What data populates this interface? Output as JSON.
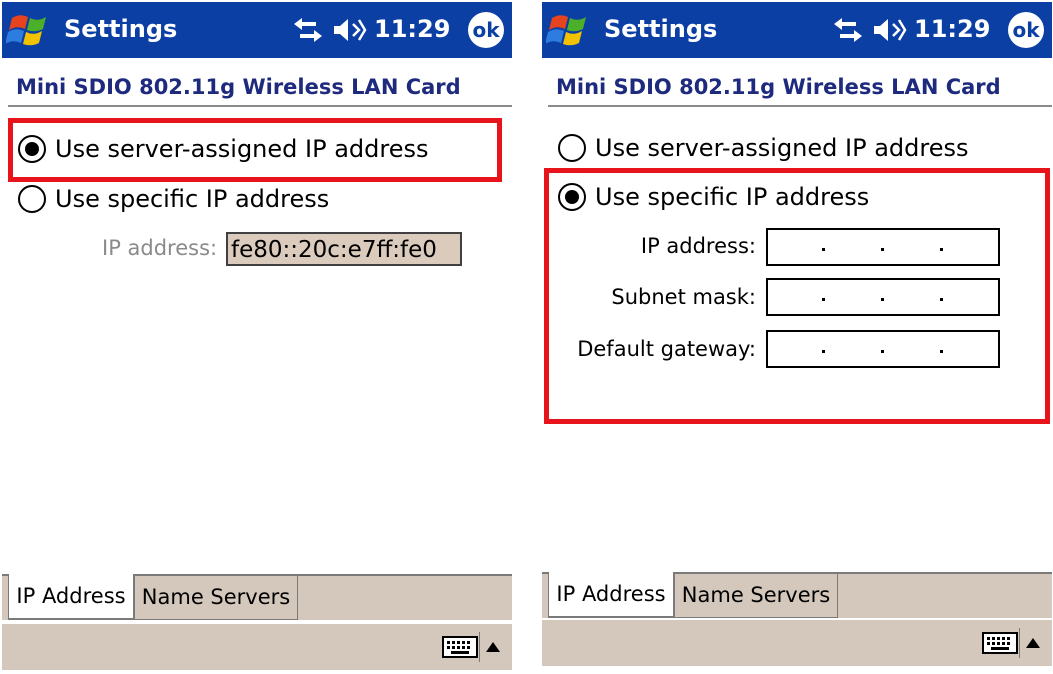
{
  "left": {
    "title": "Settings",
    "clock": "11:29",
    "ok_label": "ok",
    "heading": "Mini SDIO 802.11g Wireless LAN Card",
    "options": [
      {
        "label": "Use server-assigned IP address",
        "selected": true
      },
      {
        "label": "Use specific IP address",
        "selected": false
      }
    ],
    "ip_label": "IP address:",
    "ip_value": "fe80::20c:e7ff:fe0",
    "tabs": [
      "IP Address",
      "Name Servers"
    ]
  },
  "right": {
    "title": "Settings",
    "clock": "11:29",
    "ok_label": "ok",
    "heading": "Mini SDIO 802.11g Wireless LAN Card",
    "options": [
      {
        "label": "Use server-assigned IP address",
        "selected": false
      },
      {
        "label": "Use specific IP address",
        "selected": true
      }
    ],
    "fields": [
      {
        "label": "IP address:",
        "value": ""
      },
      {
        "label": "Subnet mask:",
        "value": ""
      },
      {
        "label": "Default gateway:",
        "value": ""
      }
    ],
    "tabs": [
      "IP Address",
      "Name Servers"
    ]
  },
  "icons": {
    "start": "windows-flag-icon",
    "connectivity": "connectivity-arrows-icon",
    "volume": "speaker-volume-icon",
    "keyboard": "keyboard-icon",
    "sip_arrow": "up-arrow-icon"
  },
  "colors": {
    "titlebar": "#0b3fa4",
    "heading_text": "#1e2a7e",
    "highlight": "#e8141c",
    "disabled_field": "#dbcbbd",
    "tabbar": "#d4c8bc"
  }
}
